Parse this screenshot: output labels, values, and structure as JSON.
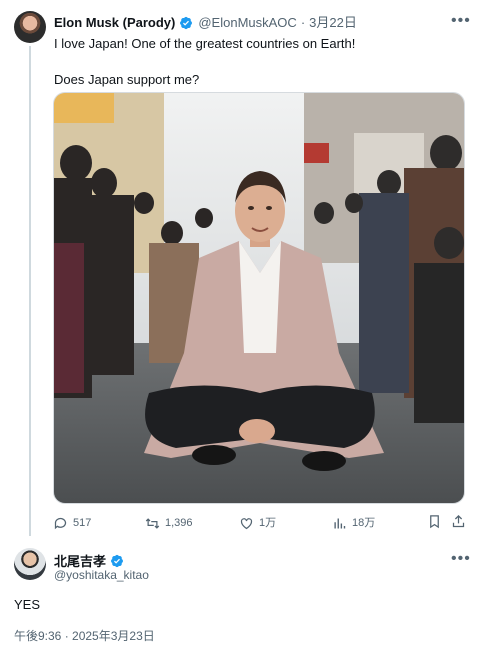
{
  "tweet1": {
    "display_name": "Elon Musk (Parody)",
    "handle": "@ElonMuskAOC",
    "separator": "·",
    "date": "3月22日",
    "text_line1": "I love Japan! One of the greatest countries on Earth!",
    "text_line2": "Does Japan support me?",
    "replies": "517",
    "reposts": "1,396",
    "likes": "1万",
    "views": "18万"
  },
  "reply": {
    "display_name": "北尾吉孝",
    "handle": "@yoshitaka_kitao",
    "text": "YES",
    "timestamp": "午後9:36 · 2025年3月23日"
  },
  "colors": {
    "verified": "#1d9bf0",
    "muted": "#536471",
    "text": "#0f1419"
  }
}
